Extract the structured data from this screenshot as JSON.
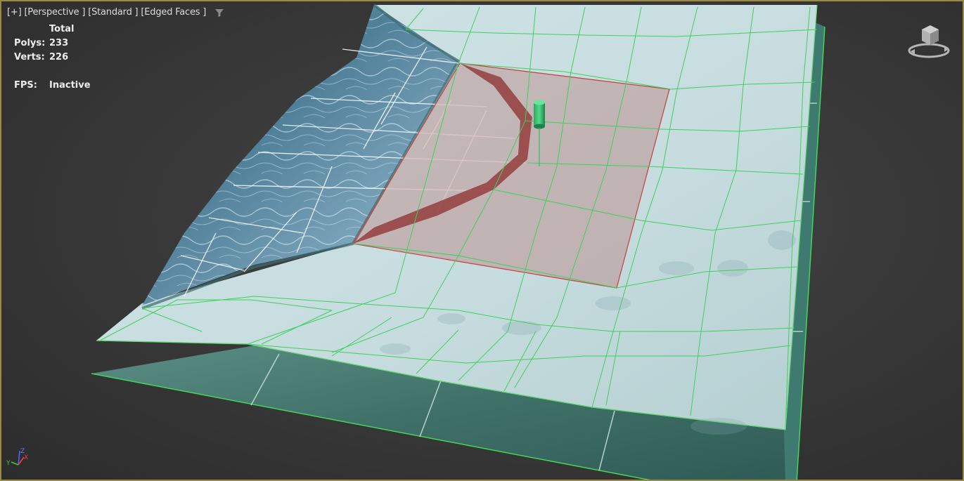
{
  "viewport": {
    "plus_menu": "[+]",
    "view_menu": "[Perspective ]",
    "shading_menu": "[Standard ]",
    "display_menu": "[Edged Faces ]",
    "filter_icon": "filter-icon"
  },
  "stats": {
    "header": "Total",
    "polys_label": "Polys:",
    "polys_value": "233",
    "verts_label": "Verts:",
    "verts_value": "226",
    "fps_label": "FPS:",
    "fps_value": "Inactive"
  },
  "axis": {
    "x": "X",
    "y": "Y",
    "z": "Z"
  },
  "colors": {
    "grid_green": "#3fd05a",
    "selection_red": "#b84848",
    "water_blue": "#5f8ea8",
    "ground_plane": "#bfd8da",
    "base_plane": "#3d7068",
    "viewport_border": "#9a8a46"
  }
}
